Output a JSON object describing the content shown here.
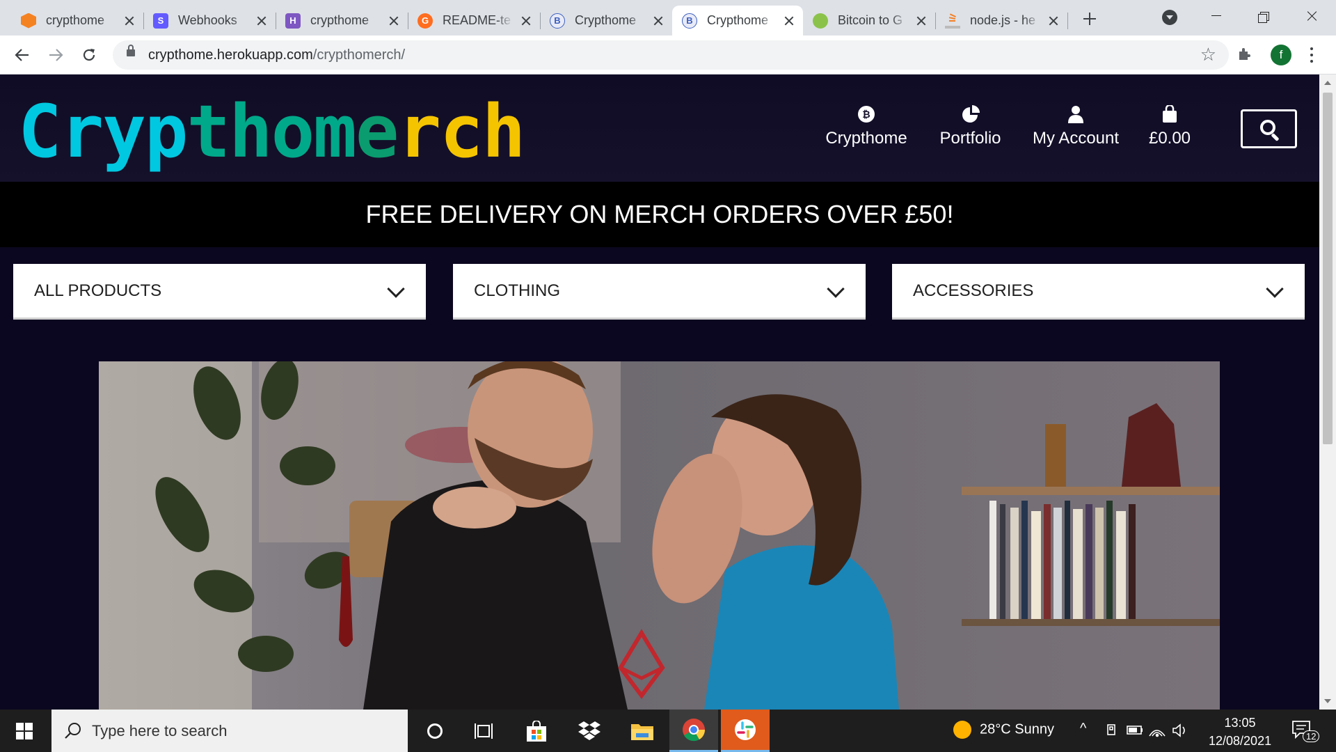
{
  "browser": {
    "tabs": [
      {
        "title": "crypthome",
        "favicon_color": "#f58220",
        "left": 0
      },
      {
        "title": "Webhooks",
        "favicon_color": "#635bff",
        "left": 0
      },
      {
        "title": "crypthome",
        "favicon_color": "#7e57c2",
        "left": 0
      },
      {
        "title": "README-te",
        "favicon_color": "#ff6d1f",
        "left": 0
      },
      {
        "title": "Crypthome",
        "favicon_color": "#3b5fbf",
        "left": 0
      },
      {
        "title": "Crypthome",
        "favicon_color": "#3b5fbf",
        "left": 0
      },
      {
        "title": "Bitcoin to G",
        "favicon_color": "#8bc34a",
        "left": 0
      },
      {
        "title": "node.js - he",
        "favicon_color": "#f48024",
        "left": 0
      }
    ],
    "favicon_letters": [
      "",
      "S",
      "H",
      "G",
      "B",
      "B",
      "",
      ""
    ],
    "url_host": "crypthome.herokuapp.com",
    "url_path": "/crypthomerch/",
    "profile_initial": "f"
  },
  "site": {
    "logo": {
      "part1": "Cryp",
      "part2": "thom",
      "part3": "e",
      "part4": "rch",
      "colors": [
        "#00c8e0",
        "#00a98a",
        "#0a9c6e",
        "#f5c400"
      ]
    },
    "nav": [
      {
        "label": "Crypthome",
        "icon": "bitcoin-icon"
      },
      {
        "label": "Portfolio",
        "icon": "pie-chart-icon"
      },
      {
        "label": "My Account",
        "icon": "user-icon"
      },
      {
        "label": "£0.00",
        "icon": "shopping-bag-icon"
      }
    ],
    "promo": "FREE DELIVERY ON MERCH ORDERS OVER £50!",
    "categories": [
      "ALL PRODUCTS",
      "CLOTHING",
      "ACCESSORIES"
    ],
    "hero_alt": "Couple embracing, man wearing black Ethereum t-shirt"
  },
  "taskbar": {
    "search_placeholder": "Type here to search",
    "weather": "28°C  Sunny",
    "time": "13:05",
    "date": "12/08/2021",
    "notifications": "12"
  }
}
